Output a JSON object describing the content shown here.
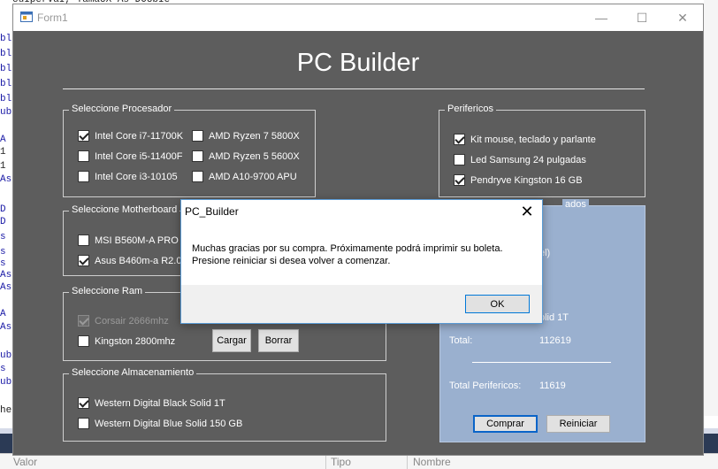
{
  "ide": {
    "top_text": "cuIpervaI, TamaUX As DOUbIe",
    "left_code": [
      "bl",
      "bl",
      "bl",
      "bl",
      "bl",
      "ub",
      "",
      "A",
      "1",
      "1",
      "As",
      "",
      "D",
      "D",
      "s",
      "s",
      "s",
      "As",
      "As",
      "",
      "A",
      "As",
      "",
      "ub",
      "s",
      "ub",
      "",
      "he"
    ],
    "panel": {
      "col1": "Valor",
      "col2": "Tipo",
      "col3": "Nombre"
    }
  },
  "window": {
    "title": "Form1",
    "controls": {
      "minimize": "—",
      "maximize": "☐",
      "close": "✕"
    }
  },
  "app": {
    "title": "PC Builder"
  },
  "processor": {
    "title": "Seleccione Procesador",
    "options": [
      {
        "label": "Intel Core i7-11700K",
        "checked": true,
        "enabled": true
      },
      {
        "label": "Intel Core i5-11400F",
        "checked": false,
        "enabled": true
      },
      {
        "label": "Intel Core i3-10105",
        "checked": false,
        "enabled": true
      },
      {
        "label": "AMD Ryzen 7 5800X",
        "checked": false,
        "enabled": true
      },
      {
        "label": "AMD Ryzen 5 5600X",
        "checked": false,
        "enabled": true
      },
      {
        "label": "AMD A10-9700 APU",
        "checked": false,
        "enabled": true
      }
    ]
  },
  "motherboard": {
    "title": "Seleccione Motherboard",
    "options": [
      {
        "label": "MSI B560M-A PRO (",
        "checked": false,
        "enabled": true
      },
      {
        "label": "Asus B460m-a R2.0 (",
        "checked": true,
        "enabled": true
      }
    ]
  },
  "ram": {
    "title": "Seleccione Ram",
    "options": [
      {
        "label": "Corsair 2666mhz",
        "checked": true,
        "enabled": false
      },
      {
        "label": "Kingston 2800mhz",
        "checked": false,
        "enabled": true
      }
    ],
    "load_button": "Cargar",
    "delete_button": "Borrar"
  },
  "storage": {
    "title": "Seleccione Almacenamiento",
    "options": [
      {
        "label": "Western Digital Black Solid 1T",
        "checked": true,
        "enabled": true
      },
      {
        "label": "Western Digital Blue Solid 150 GB",
        "checked": false,
        "enabled": true
      }
    ]
  },
  "peripherals": {
    "title": "Perifericos",
    "options": [
      {
        "label": "Kit mouse, teclado y parlante",
        "checked": true,
        "enabled": true
      },
      {
        "label": "Led Samsung 24 pulgadas",
        "checked": false,
        "enabled": true
      },
      {
        "label": "Pendryve Kingston 16 GB",
        "checked": true,
        "enabled": true
      }
    ]
  },
  "summary": {
    "title_partial": "ados",
    "line_partial_1": "el)",
    "line_partial_2": "olid 1T",
    "total_label": "Total:",
    "total_value": "112619",
    "total_peripherals_label": "Total Perifericos:",
    "total_peripherals_value": "11619",
    "buy_button": "Comprar",
    "reset_button": "Reiniciar"
  },
  "dialog": {
    "title": "PC_Builder",
    "close": "✕",
    "message_line1": "Muchas gracias por su compra. Próximamente podrá imprimir su boleta.",
    "message_line2": "Presione reiniciar si desea volver a comenzar.",
    "ok": "OK"
  }
}
